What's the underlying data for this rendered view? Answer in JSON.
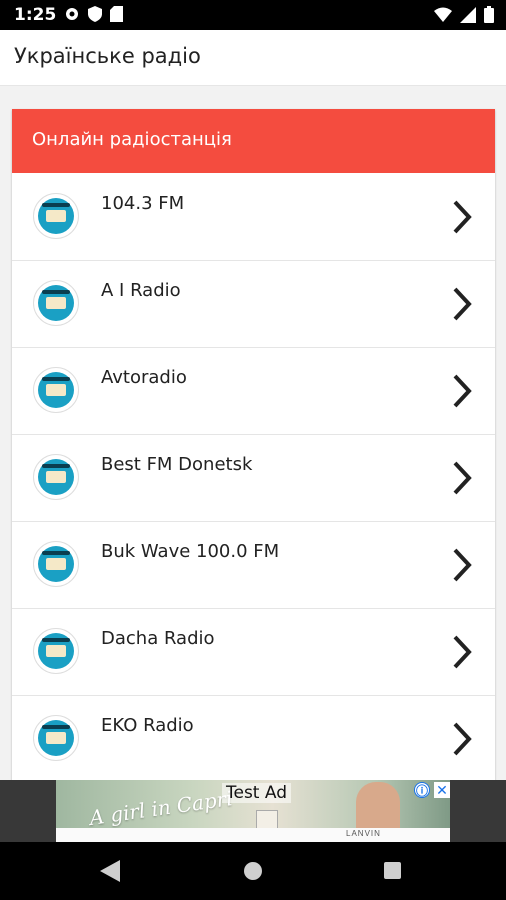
{
  "status_bar": {
    "time": "1:25",
    "left_icons": [
      "gear-icon",
      "shield-icon",
      "sd-card-icon"
    ],
    "right_icons": [
      "wifi-icon",
      "signal-icon",
      "battery-icon"
    ]
  },
  "app_bar": {
    "title": "Українське радіо"
  },
  "card": {
    "header_title": "Онлайн радіостанція",
    "header_color": "#f44c3f",
    "items": [
      {
        "name": "104.3 FM"
      },
      {
        "name": "A I Radio"
      },
      {
        "name": "Avtoradio"
      },
      {
        "name": "Best FM Donetsk"
      },
      {
        "name": "Buk Wave 100.0 FM"
      },
      {
        "name": "Dacha Radio"
      },
      {
        "name": "EKO Radio"
      }
    ]
  },
  "ad": {
    "label": "Test Ad",
    "script_text": "A girl in Capri",
    "brand": "LANVIN",
    "info_icon": "ⓘ",
    "close_icon": "✕"
  },
  "nav_bar": {
    "buttons": [
      "back-icon",
      "home-icon",
      "recents-icon"
    ]
  }
}
